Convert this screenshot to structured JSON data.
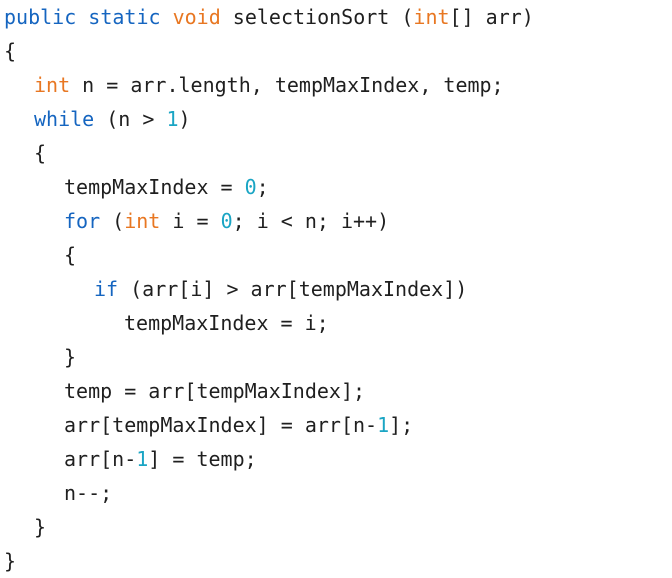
{
  "code": {
    "lines": [
      {
        "indent": 0,
        "tokens": [
          {
            "t": "public",
            "c": "kw"
          },
          {
            "t": " ",
            "c": "plain"
          },
          {
            "t": "static",
            "c": "kw"
          },
          {
            "t": " ",
            "c": "plain"
          },
          {
            "t": "void",
            "c": "type"
          },
          {
            "t": " selectionSort (",
            "c": "plain"
          },
          {
            "t": "int",
            "c": "type"
          },
          {
            "t": "[] arr)",
            "c": "plain"
          }
        ]
      },
      {
        "indent": 0,
        "tokens": [
          {
            "t": "{",
            "c": "plain"
          }
        ]
      },
      {
        "indent": 1,
        "tokens": [
          {
            "t": "int",
            "c": "type"
          },
          {
            "t": " n = arr.length, tempMaxIndex, temp;",
            "c": "plain"
          }
        ]
      },
      {
        "indent": 1,
        "tokens": [
          {
            "t": "while",
            "c": "kw"
          },
          {
            "t": " (n > ",
            "c": "plain"
          },
          {
            "t": "1",
            "c": "num"
          },
          {
            "t": ")",
            "c": "plain"
          }
        ]
      },
      {
        "indent": 1,
        "tokens": [
          {
            "t": "{",
            "c": "plain"
          }
        ]
      },
      {
        "indent": 2,
        "tokens": [
          {
            "t": "tempMaxIndex = ",
            "c": "plain"
          },
          {
            "t": "0",
            "c": "num"
          },
          {
            "t": ";",
            "c": "plain"
          }
        ]
      },
      {
        "indent": 2,
        "tokens": [
          {
            "t": "for",
            "c": "kw"
          },
          {
            "t": " (",
            "c": "plain"
          },
          {
            "t": "int",
            "c": "type"
          },
          {
            "t": " i = ",
            "c": "plain"
          },
          {
            "t": "0",
            "c": "num"
          },
          {
            "t": "; i < n; i++)",
            "c": "plain"
          }
        ]
      },
      {
        "indent": 2,
        "tokens": [
          {
            "t": "{",
            "c": "plain"
          }
        ]
      },
      {
        "indent": 3,
        "tokens": [
          {
            "t": "if",
            "c": "kw"
          },
          {
            "t": " (arr[i] > arr[tempMaxIndex])",
            "c": "plain"
          }
        ]
      },
      {
        "indent": 4,
        "tokens": [
          {
            "t": "tempMaxIndex = i;",
            "c": "plain"
          }
        ]
      },
      {
        "indent": 2,
        "tokens": [
          {
            "t": "}",
            "c": "plain"
          }
        ]
      },
      {
        "indent": 2,
        "tokens": [
          {
            "t": "temp = arr[tempMaxIndex];",
            "c": "plain"
          }
        ]
      },
      {
        "indent": 2,
        "tokens": [
          {
            "t": "arr[tempMaxIndex] = arr[n-",
            "c": "plain"
          },
          {
            "t": "1",
            "c": "num"
          },
          {
            "t": "];",
            "c": "plain"
          }
        ]
      },
      {
        "indent": 2,
        "tokens": [
          {
            "t": "arr[n-",
            "c": "plain"
          },
          {
            "t": "1",
            "c": "num"
          },
          {
            "t": "] = temp;",
            "c": "plain"
          }
        ]
      },
      {
        "indent": 2,
        "tokens": [
          {
            "t": "n--;",
            "c": "plain"
          }
        ]
      },
      {
        "indent": 1,
        "tokens": [
          {
            "t": "}",
            "c": "plain"
          }
        ]
      },
      {
        "indent": 0,
        "tokens": [
          {
            "t": "}",
            "c": "plain"
          }
        ]
      }
    ]
  },
  "colors": {
    "keyword": "#1565c0",
    "type": "#e87722",
    "number": "#1aa5c4",
    "text": "#1f1f1f",
    "background": "#ffffff"
  }
}
